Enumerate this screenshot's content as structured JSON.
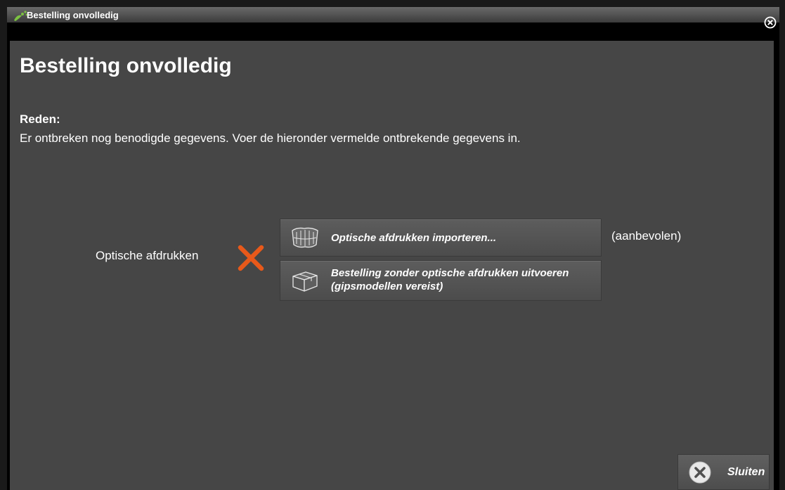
{
  "window": {
    "title": "Bestelling onvolledig",
    "app_icon": "app-logo-icon",
    "close_icon": "close-circle-icon"
  },
  "main": {
    "heading": "Bestelling onvolledig",
    "reason_label": "Reden:",
    "reason_text": "Er ontbreken nog benodigde gegevens. Voer de hieronder vermelde ontbrekende gegevens in."
  },
  "requirement": {
    "label": "Optische afdrukken",
    "status_icon": "missing-x-icon",
    "status_color": "#e8591a",
    "import_button": {
      "label": "Optische afdrukken importeren...",
      "icon": "optical-impressions-icon"
    },
    "order_button": {
      "label_line1": "Bestelling zonder optische afdrukken uitvoeren",
      "label_line2": "(gipsmodellen vereist)",
      "icon": "package-box-icon"
    },
    "recommended_note": "(aanbevolen)"
  },
  "footer": {
    "close_label": "Sluiten",
    "close_icon": "close-circle-icon"
  },
  "colors": {
    "panel_bg": "#464646",
    "title_bg": "#000000",
    "accent_x": "#e8591a"
  }
}
